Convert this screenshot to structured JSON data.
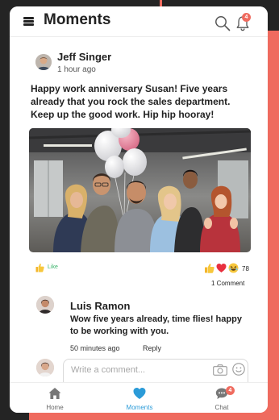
{
  "header": {
    "title": "Moments",
    "notification_count": "4"
  },
  "post": {
    "author": "Jeff Singer",
    "time": "1 hour ago",
    "text": "Happy work anniversary Susan! Five years already that you rock the sales department. Keep up the good work. Hip hip hooray!",
    "like_label": "Like",
    "reaction_count": "78",
    "comment_count": "1 Comment",
    "reactions": [
      "thumbs-up-icon",
      "heart-icon",
      "laughing-face-icon"
    ]
  },
  "comment": {
    "author": "Luis Ramon",
    "text": "Wow five years already, time flies! happy to be working with you.",
    "time": "50 minutes ago",
    "reply_label": "Reply"
  },
  "composer": {
    "placeholder": "Write a comment..."
  },
  "tabs": [
    {
      "label": "Home",
      "icon": "home-icon"
    },
    {
      "label": "Moments",
      "icon": "heart-icon",
      "active": true
    },
    {
      "label": "Chat",
      "icon": "chat-icon",
      "badge": "4"
    }
  ],
  "colors": {
    "accent": "#ef6b5f",
    "active_tab": "#2b9bd8",
    "like_green": "#3bb46b",
    "background": "#242424"
  }
}
